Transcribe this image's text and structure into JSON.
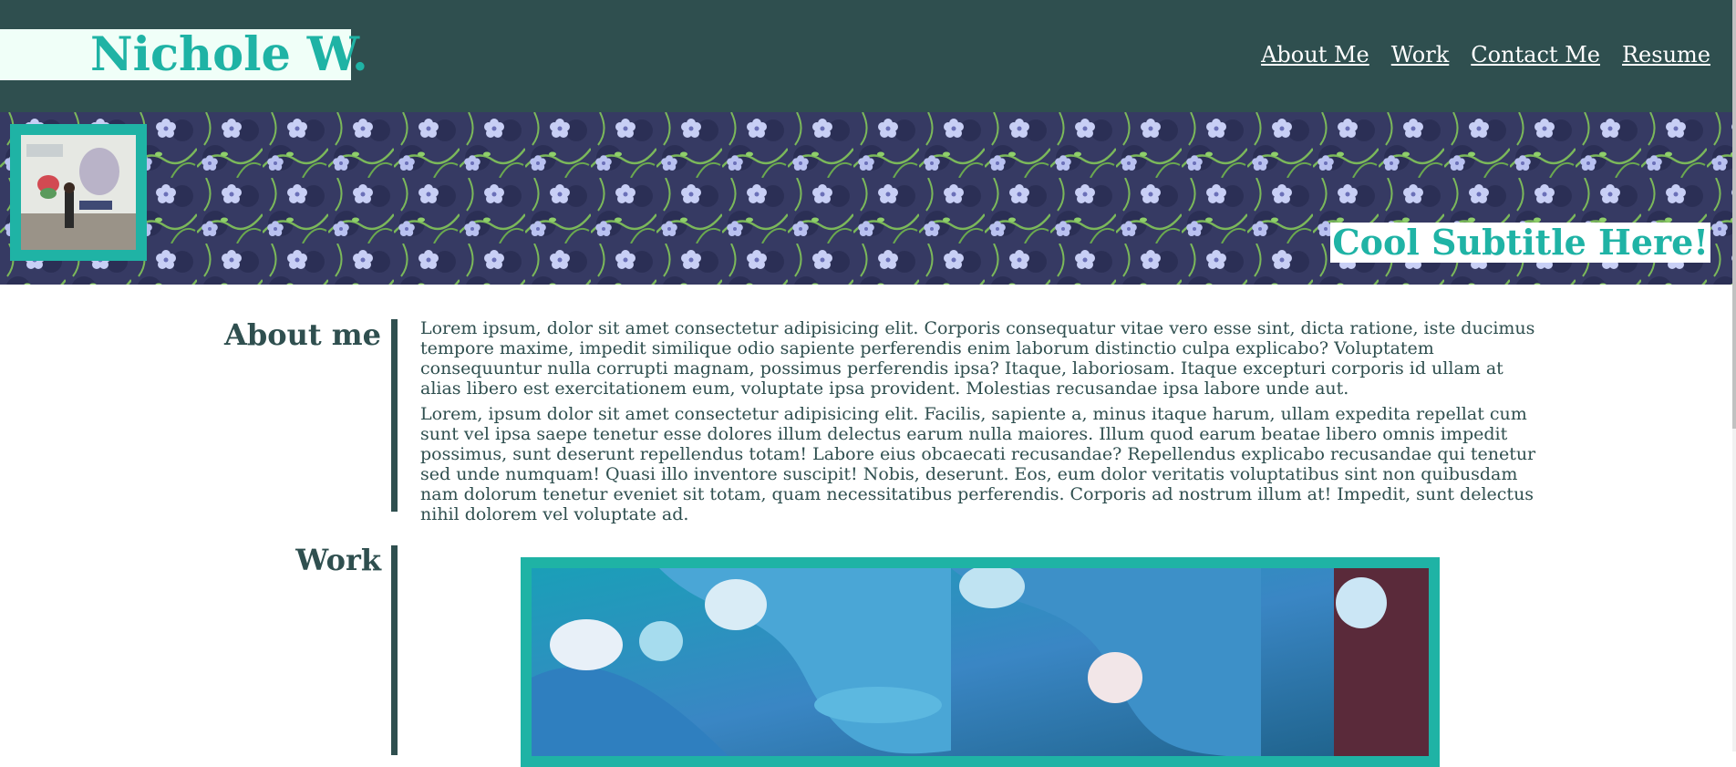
{
  "header": {
    "brand": "Nichole W.",
    "nav": [
      "About Me",
      "Work",
      "Contact Me",
      "Resume"
    ]
  },
  "banner": {
    "subtitle": "Cool Subtitle Here!"
  },
  "sections": {
    "about": {
      "title": "About me",
      "paragraphs": [
        "Lorem ipsum, dolor sit amet consectetur adipisicing elit. Corporis consequatur vitae vero esse sint, dicta ratione, iste ducimus tempore maxime, impedit similique odio sapiente perferendis enim laborum distinctio culpa explicabo? Voluptatem consequuntur nulla corrupti magnam, possimus perferendis ipsa? Itaque, laboriosam. Itaque excepturi corporis id ullam at alias libero est exercitationem eum, voluptate ipsa provident. Molestias recusandae ipsa labore unde aut.",
        "Lorem, ipsum dolor sit amet consectetur adipisicing elit. Facilis, sapiente a, minus itaque harum, ullam expedita repellat cum sunt vel ipsa saepe tenetur esse dolores illum delectus earum nulla maiores. Illum quod earum beatae libero omnis impedit possimus, sunt deserunt repellendus totam! Labore eius obcaecati recusandae? Repellendus explicabo recusandae qui tenetur sed unde numquam! Quasi illo inventore suscipit! Nobis, deserunt. Eos, eum dolor veritatis voluptatibus sint non quibusdam nam dolorum tenetur eveniet sit totam, quam necessitatibus perferendis. Corporis ad nostrum illum at! Impedit, sunt delectus nihil dolorem vel voluptate ad."
      ]
    },
    "work": {
      "title": "Work"
    }
  },
  "colors": {
    "dark": "#2f4f4f",
    "accent": "#1fb3a5",
    "banner": "#3a3f6b"
  }
}
